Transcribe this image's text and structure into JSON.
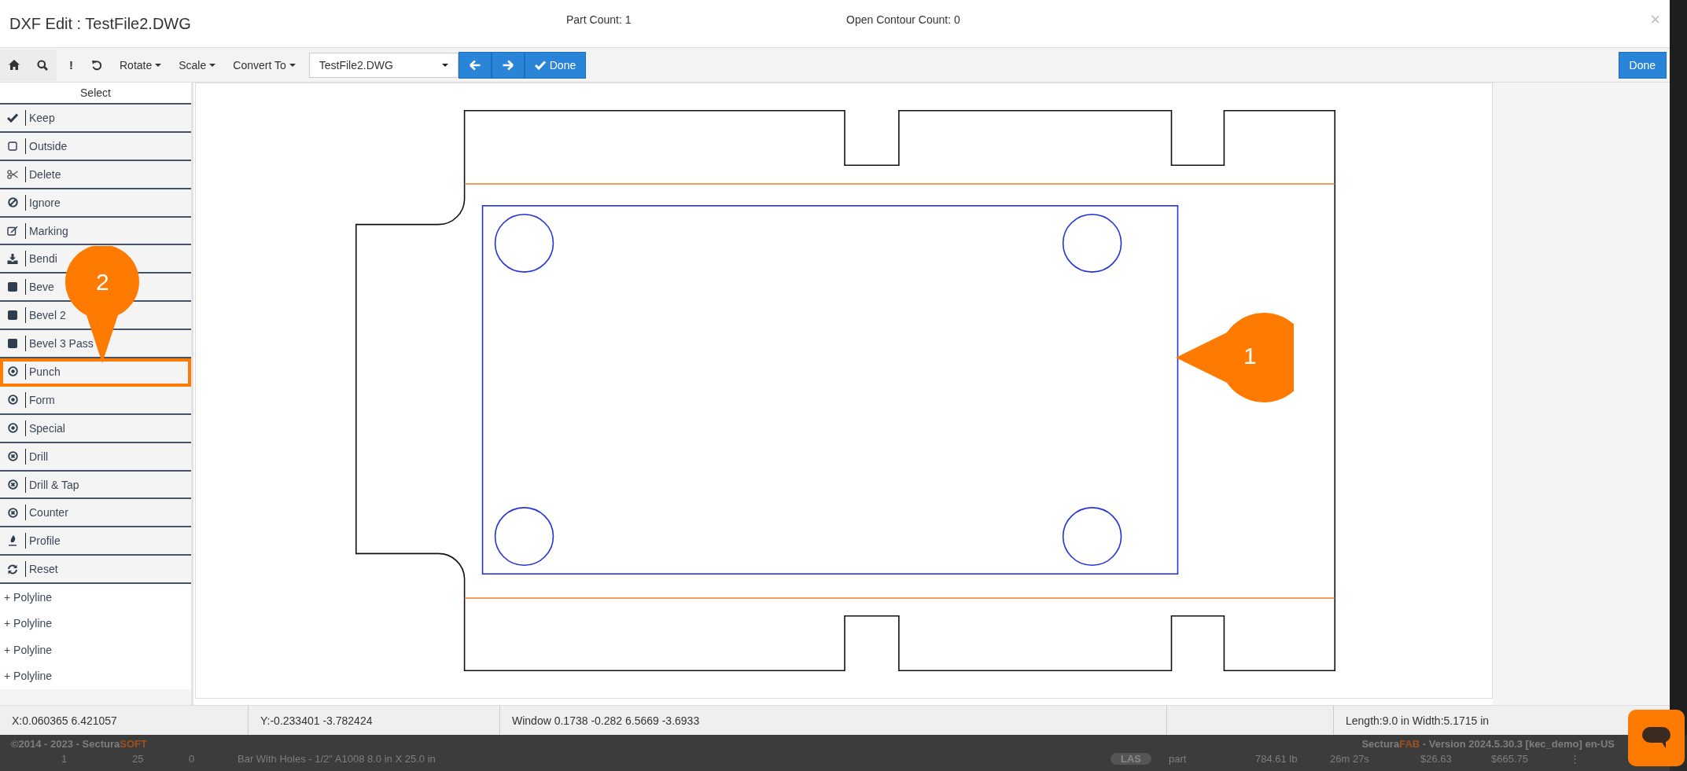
{
  "dialog": {
    "title": "DXF Edit : TestFile2.DWG",
    "part_count": "Part Count: 1",
    "open_contour_count": "Open Contour Count: 0",
    "close": "×"
  },
  "toolbar": {
    "alert": "!",
    "menus": [
      "Rotate",
      "Scale",
      "Convert To"
    ],
    "file_select": {
      "value": "TestFile2.DWG"
    },
    "done": "Done",
    "done_right": "Done"
  },
  "sidebar": {
    "header": "Select",
    "items": [
      {
        "label": "Keep",
        "highlighted": false
      },
      {
        "label": "Outside",
        "highlighted": false
      },
      {
        "label": "Delete",
        "highlighted": false
      },
      {
        "label": "Ignore",
        "highlighted": false
      },
      {
        "label": "Marking",
        "highlighted": false
      },
      {
        "label": "Bendi",
        "highlighted": false
      },
      {
        "label": "Beve",
        "highlighted": false
      },
      {
        "label": "Bevel 2",
        "highlighted": false
      },
      {
        "label": "Bevel 3 Pass",
        "highlighted": false
      },
      {
        "label": "Punch",
        "highlighted": true
      },
      {
        "label": "Form",
        "highlighted": false
      },
      {
        "label": "Special",
        "highlighted": false
      },
      {
        "label": "Drill",
        "highlighted": false
      },
      {
        "label": "Drill & Tap",
        "highlighted": false
      },
      {
        "label": "Counter",
        "highlighted": false
      },
      {
        "label": "Profile",
        "highlighted": false
      },
      {
        "label": "Reset",
        "highlighted": false
      }
    ],
    "polylines": [
      "+ Polyline",
      "+ Polyline",
      "+ Polyline",
      "+ Polyline"
    ]
  },
  "callouts": [
    {
      "label": "1"
    },
    {
      "label": "2"
    }
  ],
  "status_bar": {
    "x": "X:0.060365 6.421057",
    "y": "Y:-0.233401 -3.782424",
    "window": "Window 0.1738 -0.282 6.5669 -3.6933",
    "size": "Length:9.0 in Width:5.1715 in"
  },
  "background": {
    "copyright": "©2014 - 2023 - Sectura",
    "copyright_accent": "SOFT",
    "version_brand": "Sectura",
    "version_accent": "FAB",
    "version": " - Version 2024.5.30.3 [kec_demo] en-US",
    "row": {
      "index": "1",
      "quantity": "25",
      "attachments": "0",
      "description": "Bar With Holes - 1/2\" A1008 8.0 in X 25.0 in",
      "process": "LAS",
      "type": "part",
      "weight": "784.61 lb",
      "time": "26m 27s",
      "unit_cost": "$26.63",
      "total_cost": "$665.75",
      "more": "⋮"
    }
  }
}
